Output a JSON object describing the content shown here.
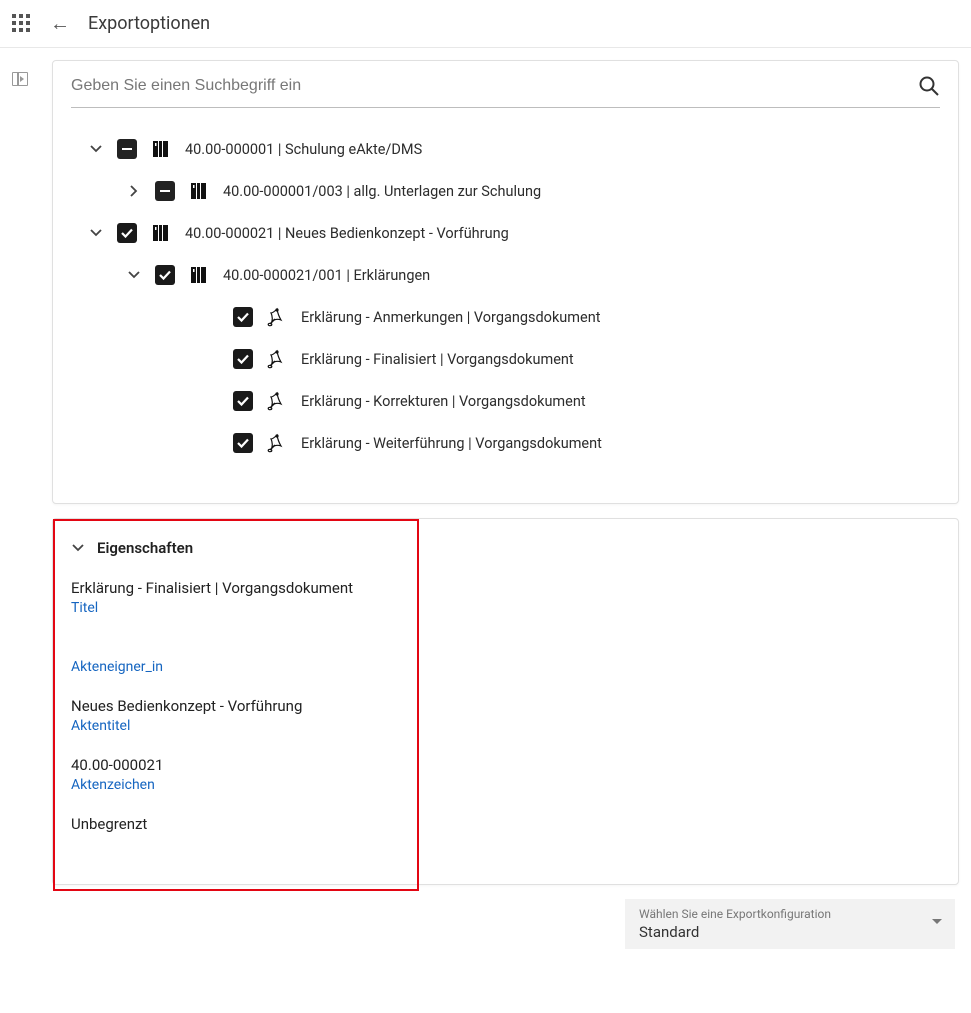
{
  "header": {
    "title": "Exportoptionen"
  },
  "search": {
    "placeholder": "Geben Sie einen Suchbegriff ein"
  },
  "tree": {
    "items": [
      {
        "indent": 1,
        "chevron": "down",
        "check": "indeterminate",
        "icon": "folder",
        "label": "40.00-000001 | Schulung eAkte/DMS"
      },
      {
        "indent": 2,
        "chevron": "right",
        "check": "indeterminate",
        "icon": "folder",
        "label": "40.00-000001/003 | allg. Unterlagen zur Schulung"
      },
      {
        "indent": 1,
        "chevron": "down",
        "check": "checked",
        "icon": "folder",
        "label": "40.00-000021 | Neues Bedienkonzept - Vorführung"
      },
      {
        "indent": 2,
        "chevron": "down",
        "check": "checked",
        "icon": "folder",
        "label": "40.00-000021/001 | Erklärungen"
      },
      {
        "indent": 4,
        "chevron": "none",
        "check": "checked",
        "icon": "pdf",
        "label": "Erklärung - Anmerkungen | Vorgangsdokument"
      },
      {
        "indent": 4,
        "chevron": "none",
        "check": "checked",
        "icon": "pdf",
        "label": "Erklärung - Finalisiert | Vorgangsdokument"
      },
      {
        "indent": 4,
        "chevron": "none",
        "check": "checked",
        "icon": "pdf",
        "label": "Erklärung - Korrekturen | Vorgangsdokument"
      },
      {
        "indent": 4,
        "chevron": "none",
        "check": "checked",
        "icon": "pdf",
        "label": "Erklärung - Weiterführung | Vorgangsdokument"
      }
    ]
  },
  "props": {
    "heading": "Eigenschaften",
    "fields": [
      {
        "value": "Erklärung - Finalisiert | Vorgangsdokument",
        "label": "Titel"
      },
      {
        "value": "",
        "label": "Akteneigner_in"
      },
      {
        "value": "Neues Bedienkonzept - Vorführung",
        "label": "Aktentitel"
      },
      {
        "value": "40.00-000021",
        "label": "Aktenzeichen"
      },
      {
        "value": "Unbegrenzt",
        "label": ""
      }
    ]
  },
  "footer": {
    "config_label": "Wählen Sie eine Exportkonfiguration",
    "config_value": "Standard"
  }
}
